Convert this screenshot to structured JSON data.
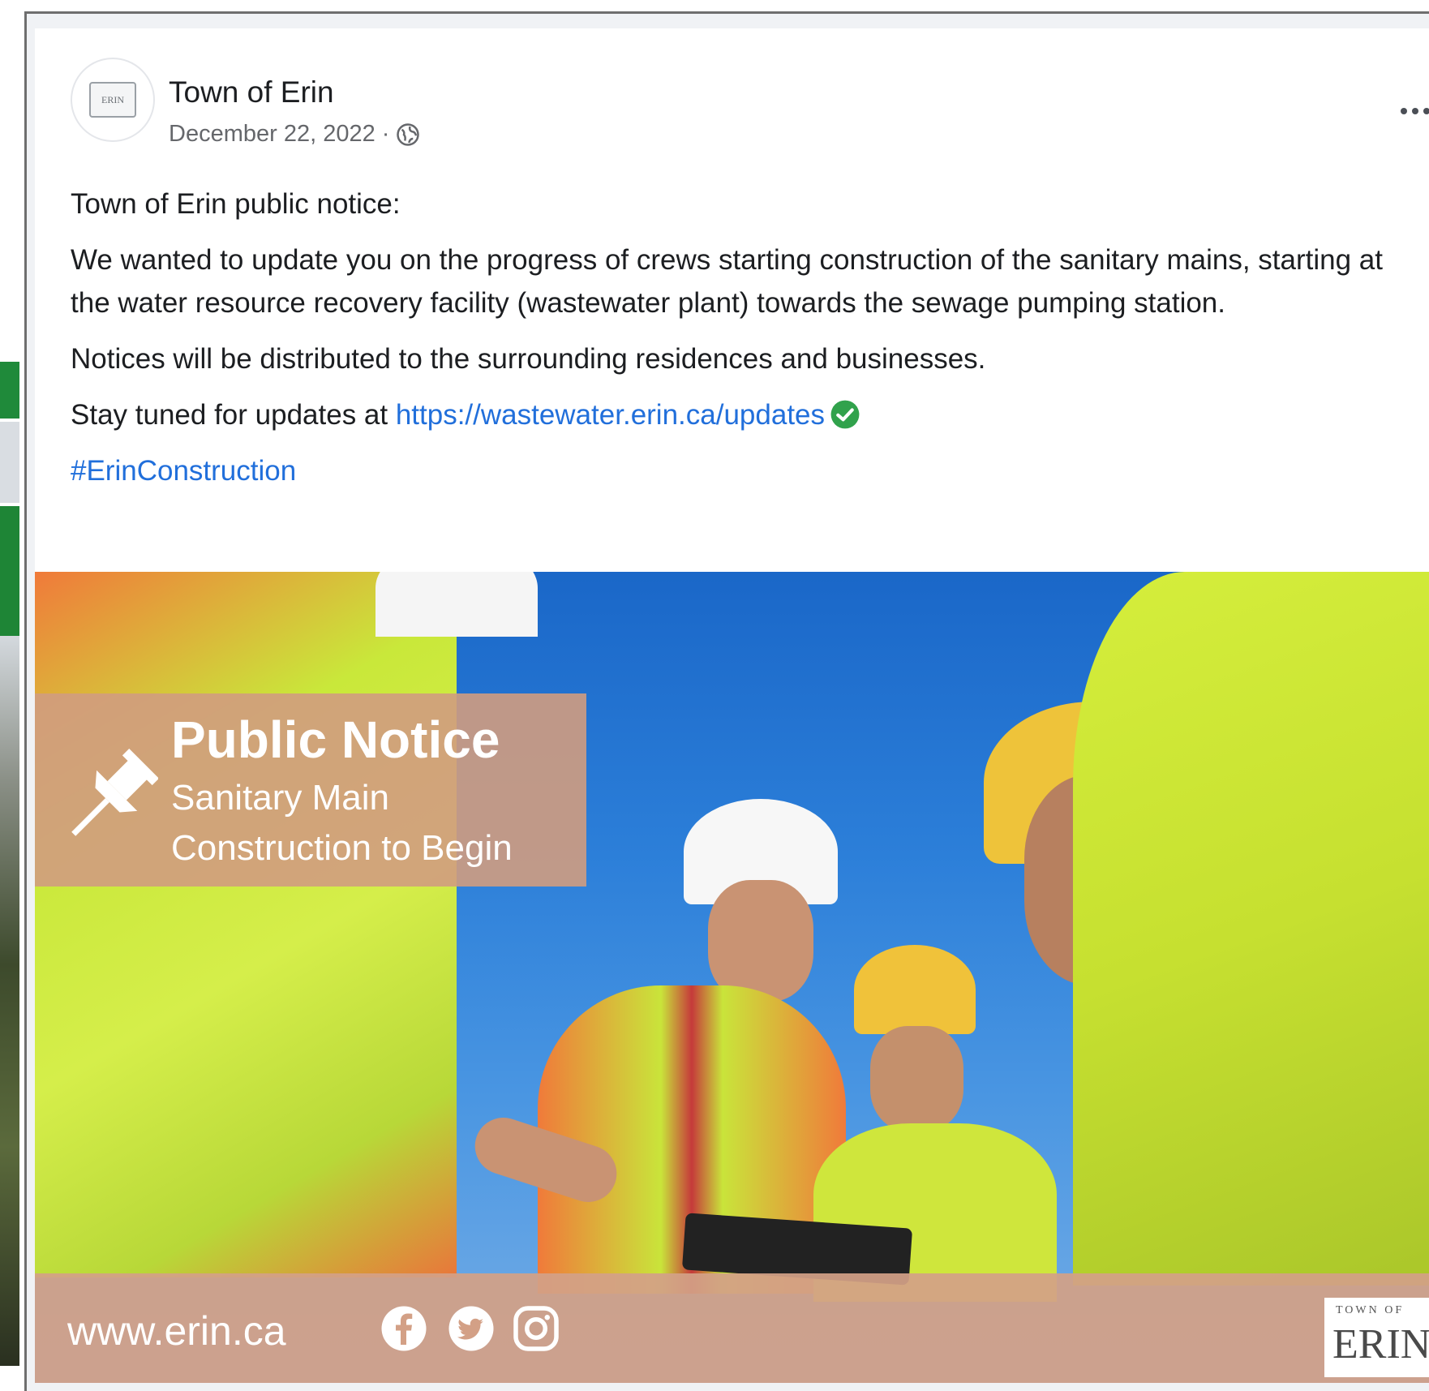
{
  "post": {
    "page_name": "Town of Erin",
    "date": "December 22, 2022 ·",
    "avatar_text": "ERIN",
    "paragraphs": {
      "p1": "Town of Erin public notice:",
      "p2": "We wanted to update you on the progress of crews starting construction of the sanitary mains, starting at the water resource recovery facility (wastewater plant) towards the sewage pumping station.",
      "p3": "Notices will be distributed to the surrounding residences  and businesses.",
      "p4_prefix": "Stay tuned for updates at ",
      "p4_link": "https://wastewater.erin.ca/updates",
      "hashtag": "#ErinConstruction"
    }
  },
  "image": {
    "notice_title": "Public Notice",
    "notice_line1": "Sanitary Main",
    "notice_line2": "Construction to Begin",
    "footer_url": "www.erin.ca",
    "logo_small": "TOWN OF",
    "logo_big": "ERIN"
  },
  "icons": {
    "globe": "globe-icon",
    "verified": "verified-check-icon",
    "more": "more-options-icon",
    "pin": "pushpin-icon",
    "facebook": "facebook-icon",
    "twitter": "twitter-icon",
    "instagram": "instagram-icon"
  },
  "colors": {
    "link": "#216fdb",
    "verified": "#31a24c",
    "notice_overlay": "#d09c80"
  }
}
